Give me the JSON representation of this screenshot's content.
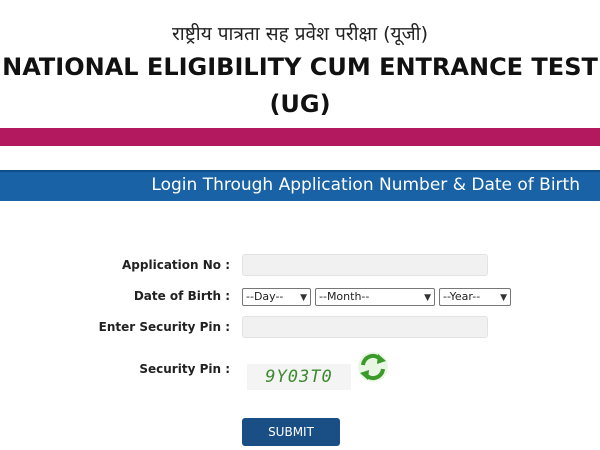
{
  "header": {
    "hindi_title": "राष्ट्रीय पात्रता सह प्रवेश परीक्षा (यूजी)",
    "title_line1": "NATIONAL ELIGIBILITY CUM ENTRANCE TEST",
    "title_line2": "(UG)",
    "accent_color": "#b3195f"
  },
  "login_bar": {
    "text": "Login Through Application Number & Date of Birth",
    "color": "#1a62a6"
  },
  "form": {
    "application_no_label": "Application No :",
    "application_no_value": "",
    "dob_label": "Date of Birth :",
    "day_selected": "--Day--",
    "month_selected": "--Month--",
    "year_selected": "--Year--",
    "security_pin_input_label": "Enter Security Pin :",
    "security_pin_input_value": "",
    "security_pin_label": "Security Pin :",
    "captcha_text": "9Y03T0",
    "refresh_icon": "refresh-icon",
    "submit_label": "SUBMIT"
  }
}
